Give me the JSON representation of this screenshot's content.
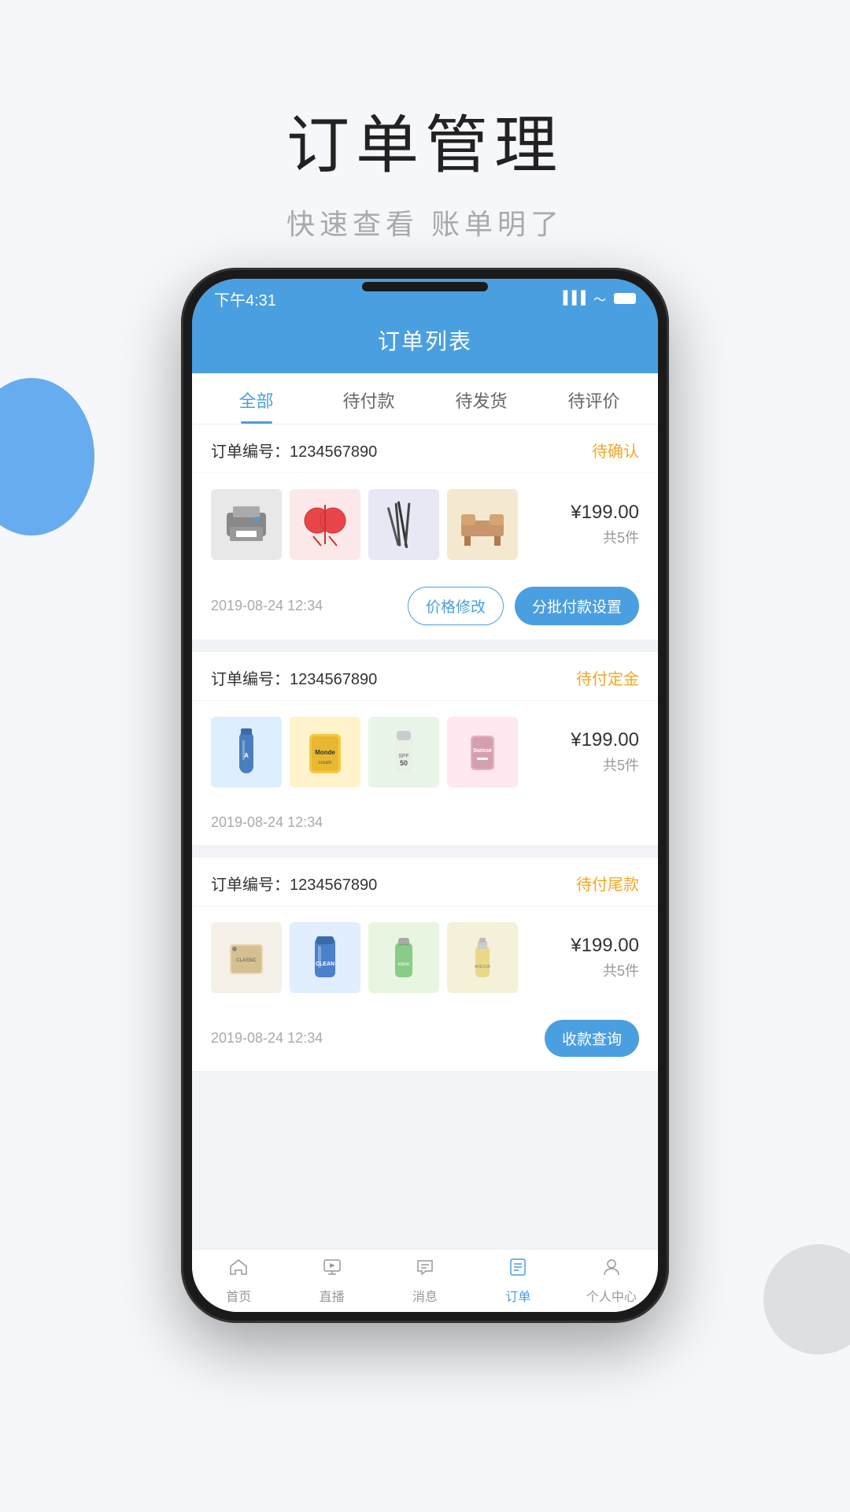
{
  "page": {
    "title": "订单管理",
    "subtitle": "快速查看  账单明了"
  },
  "statusBar": {
    "time": "下午4:31",
    "signal": "📶",
    "wifi": "📡",
    "battery": "🔋"
  },
  "appHeader": {
    "title": "订单列表"
  },
  "tabs": [
    {
      "id": "all",
      "label": "全部",
      "active": true
    },
    {
      "id": "pending_pay",
      "label": "待付款",
      "active": false
    },
    {
      "id": "pending_ship",
      "label": "待发货",
      "active": false
    },
    {
      "id": "pending_review",
      "label": "待评价",
      "active": false
    }
  ],
  "orders": [
    {
      "id": "order-1",
      "orderNo": "订单编号：1234567890",
      "status": "待确认",
      "statusClass": "status-pending",
      "products": [
        {
          "id": "p1",
          "colorClass": "img-printer"
        },
        {
          "id": "p2",
          "colorClass": "img-decor"
        },
        {
          "id": "p3",
          "colorClass": "img-brush"
        },
        {
          "id": "p4",
          "colorClass": "img-furniture"
        }
      ],
      "price": "¥199.00",
      "count": "共5件",
      "date": "2019-08-24 12:34",
      "actions": [
        {
          "id": "price-modify",
          "label": "价格修改",
          "type": "outline"
        },
        {
          "id": "batch-pay",
          "label": "分批付款设置",
          "type": "solid"
        }
      ]
    },
    {
      "id": "order-2",
      "orderNo": "订单编号：1234567890",
      "status": "待付定金",
      "statusClass": "status-deposit",
      "products": [
        {
          "id": "p5",
          "colorClass": "img-bottle"
        },
        {
          "id": "p6",
          "colorClass": "img-snack"
        },
        {
          "id": "p7",
          "colorClass": "img-cream"
        },
        {
          "id": "p8",
          "colorClass": "img-medicine"
        }
      ],
      "price": "¥199.00",
      "count": "共5件",
      "date": "2019-08-24 12:34",
      "actions": []
    },
    {
      "id": "order-3",
      "orderNo": "订单编号：1234567890",
      "status": "待付尾款",
      "statusClass": "status-balance",
      "products": [
        {
          "id": "p9",
          "colorClass": "img-pasta"
        },
        {
          "id": "p10",
          "colorClass": "img-cleaner"
        },
        {
          "id": "p11",
          "colorClass": "img-lotion"
        },
        {
          "id": "p12",
          "colorClass": "img-serum"
        }
      ],
      "price": "¥199.00",
      "count": "共5件",
      "date": "2019-08-24 12:34",
      "actions": [
        {
          "id": "payment-inquiry",
          "label": "收款查询",
          "type": "solid"
        }
      ]
    }
  ],
  "bottomNav": [
    {
      "id": "home",
      "icon": "⌂",
      "label": "首页",
      "active": false
    },
    {
      "id": "live",
      "icon": "▶",
      "label": "直播",
      "active": false
    },
    {
      "id": "message",
      "icon": "💬",
      "label": "消息",
      "active": false
    },
    {
      "id": "order",
      "icon": "☰",
      "label": "订单",
      "active": true
    },
    {
      "id": "profile",
      "icon": "👤",
      "label": "个人中心",
      "active": false
    }
  ]
}
